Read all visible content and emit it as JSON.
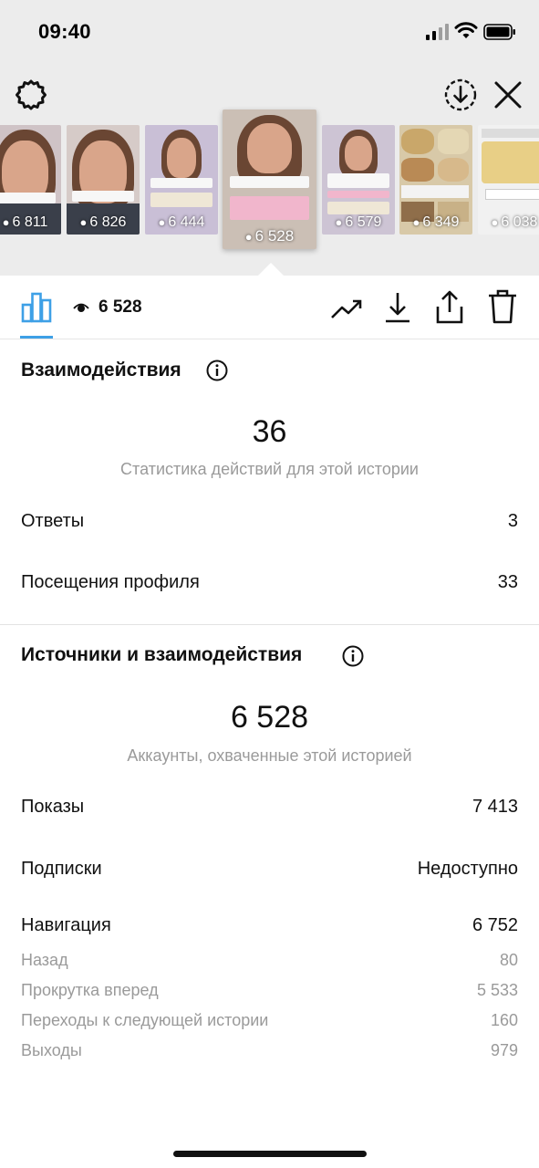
{
  "status_bar": {
    "time": "09:40"
  },
  "thumbnails": [
    {
      "views": "6 811"
    },
    {
      "views": "6 826"
    },
    {
      "views": "6 444"
    },
    {
      "views": "6 528",
      "selected": true
    },
    {
      "views": "6 579"
    },
    {
      "views": "6 349"
    },
    {
      "views": "6 038"
    }
  ],
  "tab_bar": {
    "views": "6 528"
  },
  "interactions": {
    "title": "Взаимодействия",
    "total": "36",
    "caption": "Статистика действий для этой истории",
    "rows": [
      {
        "label": "Ответы",
        "value": "3"
      },
      {
        "label": "Посещения профиля",
        "value": "33"
      }
    ]
  },
  "discovery": {
    "title": "Источники и взаимодействия",
    "total": "6 528",
    "caption": "Аккаунты, охваченные этой историей",
    "rows": [
      {
        "label": "Показы",
        "value": "7 413"
      },
      {
        "label": "Подписки",
        "value": "Недоступно"
      },
      {
        "label": "Навигация",
        "value": "6 752"
      }
    ],
    "navigation": [
      {
        "label": "Назад",
        "value": "80"
      },
      {
        "label": "Прокрутка вперед",
        "value": "5 533"
      },
      {
        "label": "Переходы к следующей истории",
        "value": "160"
      },
      {
        "label": "Выходы",
        "value": "979"
      }
    ]
  },
  "colors": {
    "accent": "#3ea0e6",
    "muted": "#9a9a9a",
    "top_bg": "#ececec"
  },
  "icons": [
    "gear-icon",
    "download-circle-icon",
    "close-icon",
    "bar-chart-icon",
    "eye-icon",
    "trend-icon",
    "download-icon",
    "share-icon",
    "trash-icon",
    "info-icon"
  ]
}
